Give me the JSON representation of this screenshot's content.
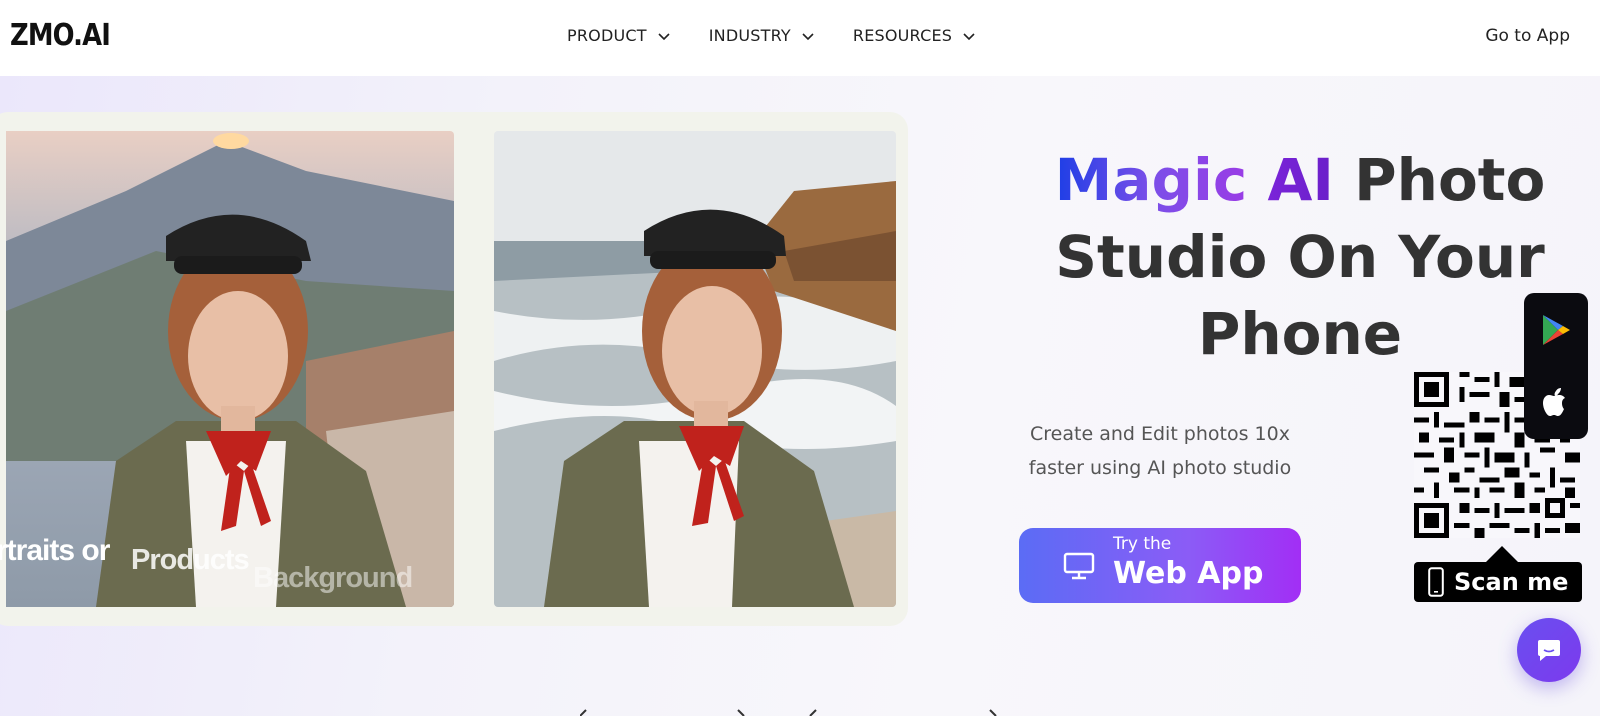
{
  "header": {
    "logo": "ZMO.AI",
    "nav": [
      {
        "label": "PRODUCT"
      },
      {
        "label": "INDUSTRY"
      },
      {
        "label": "RESOURCES"
      }
    ],
    "go_to_app": "Go to App"
  },
  "gallery": {
    "rotating_words": [
      "rtraits or",
      "Products",
      "Background"
    ]
  },
  "hero": {
    "title_magic": "Magic",
    "title_ai": "AI",
    "title_photo": "Photo",
    "title_line2": "Studio On Your",
    "title_line3": "Phone",
    "subtitle_line1": "Create and Edit photos 10x",
    "subtitle_line2": "faster using AI photo studio"
  },
  "cta": {
    "small": "Try the",
    "big": "Web App"
  },
  "qr": {
    "scan_label": "Scan me"
  },
  "colors": {
    "cta_start": "#5b6cf5",
    "cta_end": "#a22ef5",
    "magic_blue": "#1d3ee6",
    "ai_purple": "#7a24d9",
    "chat_bubble": "#6a4ff0"
  },
  "icons": [
    "chevron-down-icon",
    "monitor-icon",
    "phone-icon",
    "google-play-icon",
    "apple-icon",
    "chat-icon"
  ]
}
